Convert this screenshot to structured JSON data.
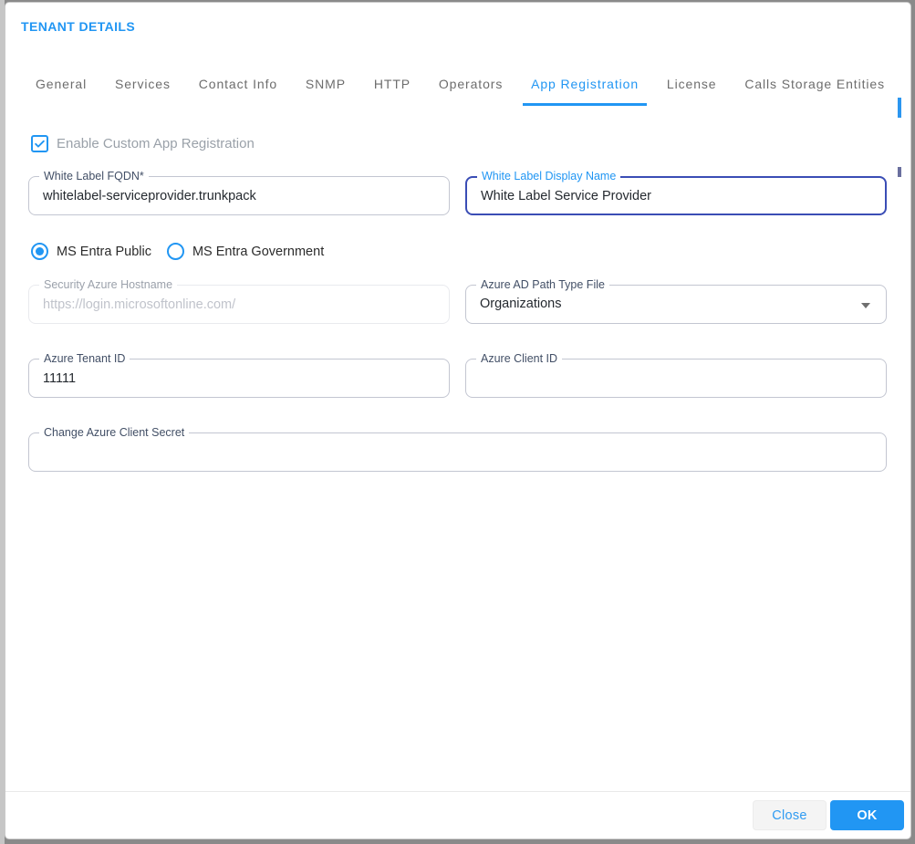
{
  "dialog": {
    "title": "TENANT DETAILS"
  },
  "tabs": [
    {
      "label": "General",
      "active": false
    },
    {
      "label": "Services",
      "active": false
    },
    {
      "label": "Contact Info",
      "active": false
    },
    {
      "label": "SNMP",
      "active": false
    },
    {
      "label": "HTTP",
      "active": false
    },
    {
      "label": "Operators",
      "active": false
    },
    {
      "label": "App Registration",
      "active": true
    },
    {
      "label": "License",
      "active": false
    },
    {
      "label": "Calls Storage Entities",
      "active": false
    }
  ],
  "form": {
    "enable_checkbox": {
      "label": "Enable Custom App Registration",
      "checked": true
    },
    "white_label_fqdn": {
      "label": "White Label FQDN*",
      "value": "whitelabel-serviceprovider.trunkpack"
    },
    "white_label_display_name": {
      "label": "White Label Display Name",
      "value": "White Label Service Provider",
      "focused": true
    },
    "radios": [
      {
        "label": "MS Entra Public",
        "selected": true
      },
      {
        "label": "MS Entra Government",
        "selected": false
      }
    ],
    "security_azure_hostname": {
      "label": "Security Azure Hostname",
      "placeholder": "https://login.microsoftonline.com/",
      "value": "",
      "disabled": true
    },
    "azure_ad_path_type": {
      "label": "Azure AD Path Type File",
      "value": "Organizations"
    },
    "azure_tenant_id": {
      "label": "Azure Tenant ID",
      "value": "11111"
    },
    "azure_client_id": {
      "label": "Azure Client ID",
      "value": ""
    },
    "change_azure_client_secret": {
      "label": "Change Azure Client Secret",
      "value": ""
    }
  },
  "footer": {
    "close_label": "Close",
    "ok_label": "OK"
  },
  "colors": {
    "accent": "#2196f3",
    "focused_border": "#3a4db5",
    "field_border": "#c3c6d1",
    "label_text": "#424f66",
    "tab_text": "#6d6d6d"
  }
}
